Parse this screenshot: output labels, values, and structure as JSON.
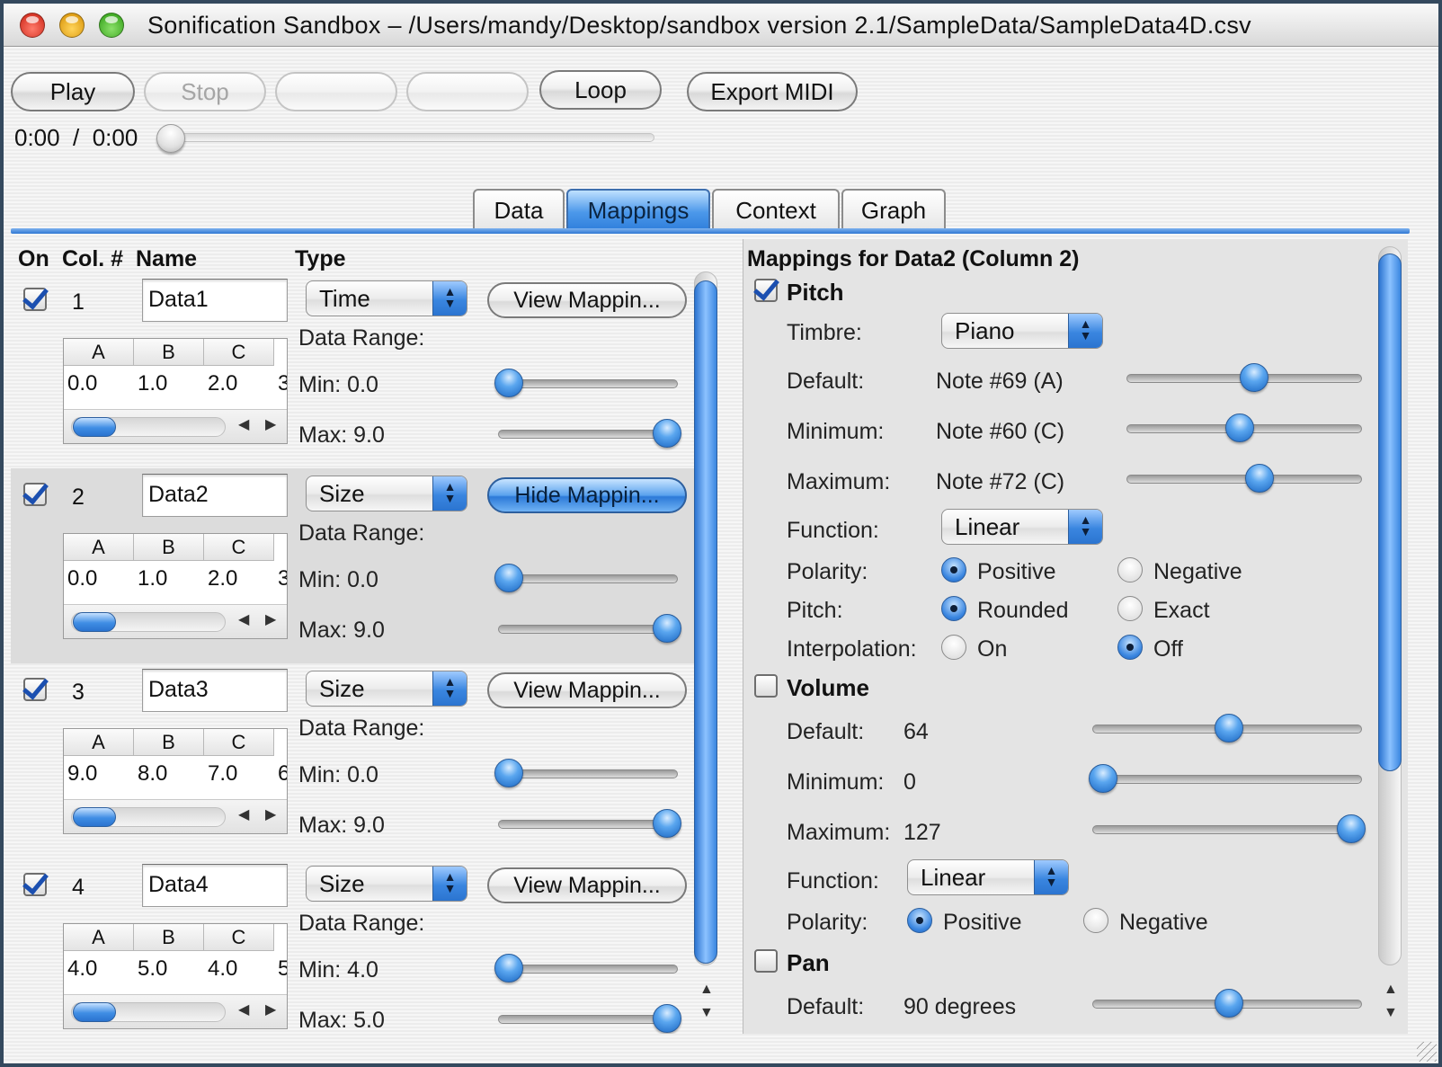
{
  "window": {
    "title": "Sonification Sandbox – /Users/mandy/Desktop/sandbox version 2.1/SampleData/SampleData4D.csv"
  },
  "toolbar": {
    "play_label": "Play",
    "stop_label": "Stop",
    "blank1_label": "",
    "blank2_label": "",
    "loop_label": "Loop",
    "export_label": "Export MIDI",
    "time_display": "0:00  /  0:00",
    "playback_progress": 0
  },
  "tabs": [
    {
      "label": "Data"
    },
    {
      "label": "Mappings"
    },
    {
      "label": "Context"
    },
    {
      "label": "Graph"
    }
  ],
  "active_tab": "Mappings",
  "left": {
    "headers": {
      "on": "On",
      "col": "Col. #",
      "name": "Name",
      "type": "Type"
    },
    "range_title": "Data Range:",
    "rows": [
      {
        "on": true,
        "col": "1",
        "name": "Data1",
        "type": "Time",
        "button": "View Mappin...",
        "table": {
          "headers": [
            "A",
            "B",
            "C"
          ],
          "values": [
            "0.0",
            "1.0",
            "2.0",
            "3"
          ]
        },
        "min": "Min: 0.0",
        "max": "Max: 9.0"
      },
      {
        "on": true,
        "col": "2",
        "name": "Data2",
        "type": "Size",
        "button": "Hide Mappin...",
        "table": {
          "headers": [
            "A",
            "B",
            "C"
          ],
          "values": [
            "0.0",
            "1.0",
            "2.0",
            "3"
          ]
        },
        "min": "Min: 0.0",
        "max": "Max: 9.0"
      },
      {
        "on": true,
        "col": "3",
        "name": "Data3",
        "type": "Size",
        "button": "View Mappin...",
        "table": {
          "headers": [
            "A",
            "B",
            "C"
          ],
          "values": [
            "9.0",
            "8.0",
            "7.0",
            "6"
          ]
        },
        "min": "Min: 0.0",
        "max": "Max: 9.0"
      },
      {
        "on": true,
        "col": "4",
        "name": "Data4",
        "type": "Size",
        "button": "View Mappin...",
        "table": {
          "headers": [
            "A",
            "B",
            "C"
          ],
          "values": [
            "4.0",
            "5.0",
            "4.0",
            "5"
          ]
        },
        "min": "Min: 4.0",
        "max": "Max: 5.0"
      }
    ]
  },
  "right": {
    "heading": "Mappings for Data2 (Column 2)",
    "pitch": {
      "title": "Pitch",
      "enabled": true,
      "timbre_label": "Timbre:",
      "timbre_value": "Piano",
      "default_label": "Default:",
      "default_value": "Note #69 (A)",
      "minimum_label": "Minimum:",
      "minimum_value": "Note #60 (C)",
      "maximum_label": "Maximum:",
      "maximum_value": "Note #72 (C)",
      "function_label": "Function:",
      "function_value": "Linear",
      "polarity_label": "Polarity:",
      "polarity_pos": "Positive",
      "polarity_neg": "Negative",
      "pitch_label": "Pitch:",
      "pitch_rounded": "Rounded",
      "pitch_exact": "Exact",
      "interp_label": "Interpolation:",
      "interp_on": "On",
      "interp_off": "Off"
    },
    "volume": {
      "title": "Volume",
      "enabled": false,
      "default_label": "Default:",
      "default_value": "64",
      "minimum_label": "Minimum:",
      "minimum_value": "0",
      "maximum_label": "Maximum:",
      "maximum_value": "127",
      "function_label": "Function:",
      "function_value": "Linear",
      "polarity_label": "Polarity:",
      "polarity_pos": "Positive",
      "polarity_neg": "Negative"
    },
    "pan": {
      "title": "Pan",
      "enabled": false,
      "default_label": "Default:",
      "default_value": "90 degrees"
    }
  },
  "icons": {
    "close": "close-traffic-light-icon",
    "minimize": "minimize-traffic-light-icon",
    "zoom": "zoom-traffic-light-icon",
    "select": "up-down-arrows-icon",
    "resize": "resize-grip-icon"
  },
  "colors": {
    "accent_blue": "#3a86e0",
    "window_border": "#34495e"
  }
}
